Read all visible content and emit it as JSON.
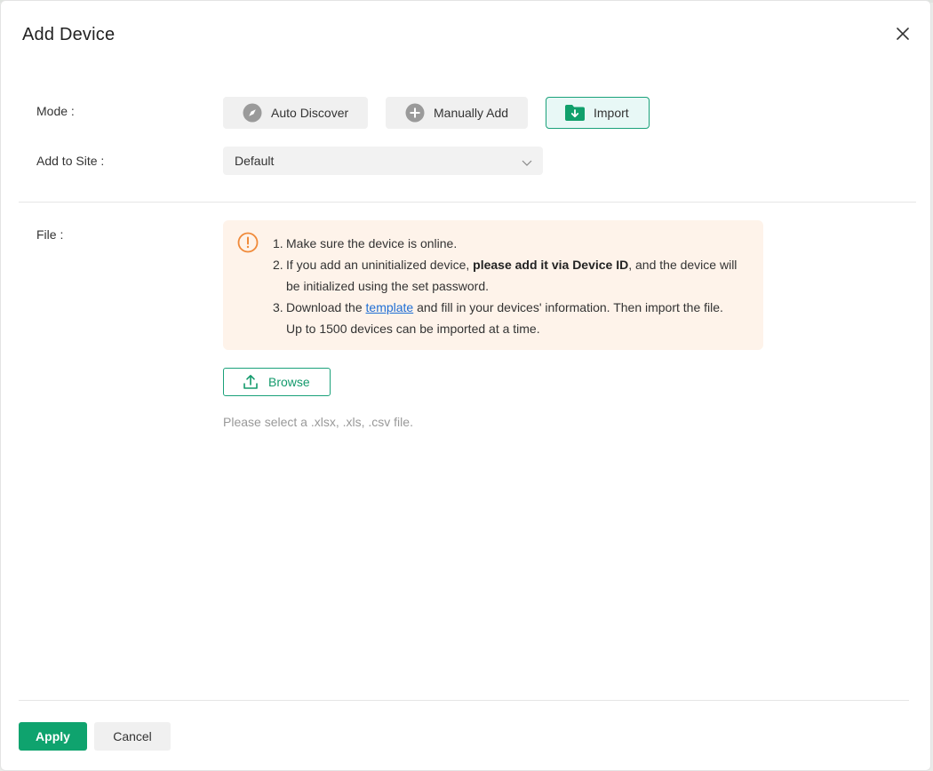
{
  "dialog": {
    "title": "Add Device"
  },
  "mode": {
    "label": "Mode :",
    "options": [
      {
        "label": "Auto Discover",
        "icon": "compass-icon",
        "active": false
      },
      {
        "label": "Manually Add",
        "icon": "plus-circle-icon",
        "active": false
      },
      {
        "label": "Import",
        "icon": "folder-download-icon",
        "active": true
      }
    ]
  },
  "site": {
    "label": "Add to Site :",
    "selected": "Default"
  },
  "file": {
    "label": "File :",
    "notice": {
      "item1": {
        "num": "1.",
        "text": "Make sure the device is online."
      },
      "item2": {
        "num": "2.",
        "pre": "If you add an uninitialized device, ",
        "bold": "please add it via Device ID",
        "post": ", and the device will",
        "line2": "be initialized using the set password."
      },
      "item3": {
        "num": "3.",
        "pre": "Download the ",
        "link": "template",
        "post": " and fill in your devices' information. Then import the file.",
        "line2": "Up to 1500 devices can be imported at a time."
      }
    },
    "browse_label": "Browse",
    "hint": "Please select a .xlsx, .xls, .csv file."
  },
  "footer": {
    "apply_label": "Apply",
    "cancel_label": "Cancel"
  },
  "colors": {
    "accent": "#0fa36e",
    "notice_bg": "#fef3ea",
    "warning": "#f08a3a",
    "link": "#1f6ed4"
  }
}
